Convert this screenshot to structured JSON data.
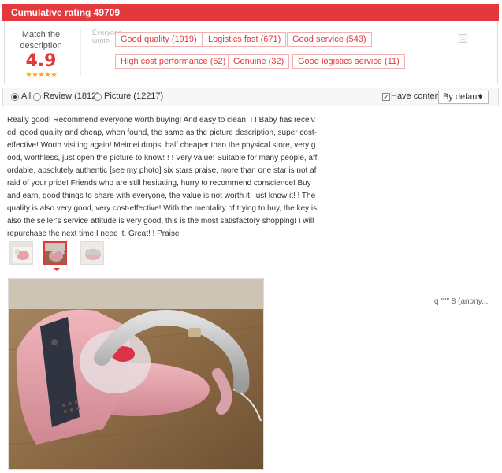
{
  "header": {
    "title": "Cumulative rating 49709"
  },
  "rating": {
    "match_label_line1": "Match the",
    "match_label_line2": "description",
    "score": "4.9",
    "stars": "★★★★★",
    "everyone_line1": "Everyone",
    "everyone_line2": "wrote"
  },
  "tags": [
    "Good quality (1919)",
    "Logistics fast (671)",
    "Good service (543)",
    "High cost performance (52)",
    "Genuine (32)",
    "Good logistics service (11)"
  ],
  "toggle_icon": "⌄",
  "filters": {
    "all": "All",
    "review": "Review (1812)",
    "picture": "Picture (12217)",
    "selected": "All",
    "has_content": "Have content",
    "has_content_checked": true,
    "sort_label": "By default",
    "sort_caret": "▼"
  },
  "review": {
    "text": "Really good! Recommend everyone worth buying! And easy to clean! ! ! Baby has received, good quality and cheap, when found, the same as the picture description, super cost-effective! Worth visiting again! Meimei drops, half cheaper than the physical store, very good, worthless, just open the picture to know! ! ! Very value! Suitable for many people, affordable, absolutely authentic [see my photo] six stars praise, more than one star is not afraid of your pride! Friends who are still hesitating, hurry to recommend conscience! Buy and earn, good things to share with everyone, the value is not worth it, just know it! ! The quality is also very good, very cost-effective! With the mentality of trying to buy, the key is also the seller's service attitude is very good, this is the most satisfactory shopping! I will repurchase the next time I need it. Great! ! Praise",
    "thumb_selected_index": 1,
    "user": "q \"\"\" 8 (anony..."
  },
  "colors": {
    "accent": "#e4393c",
    "star": "#f5a623"
  }
}
